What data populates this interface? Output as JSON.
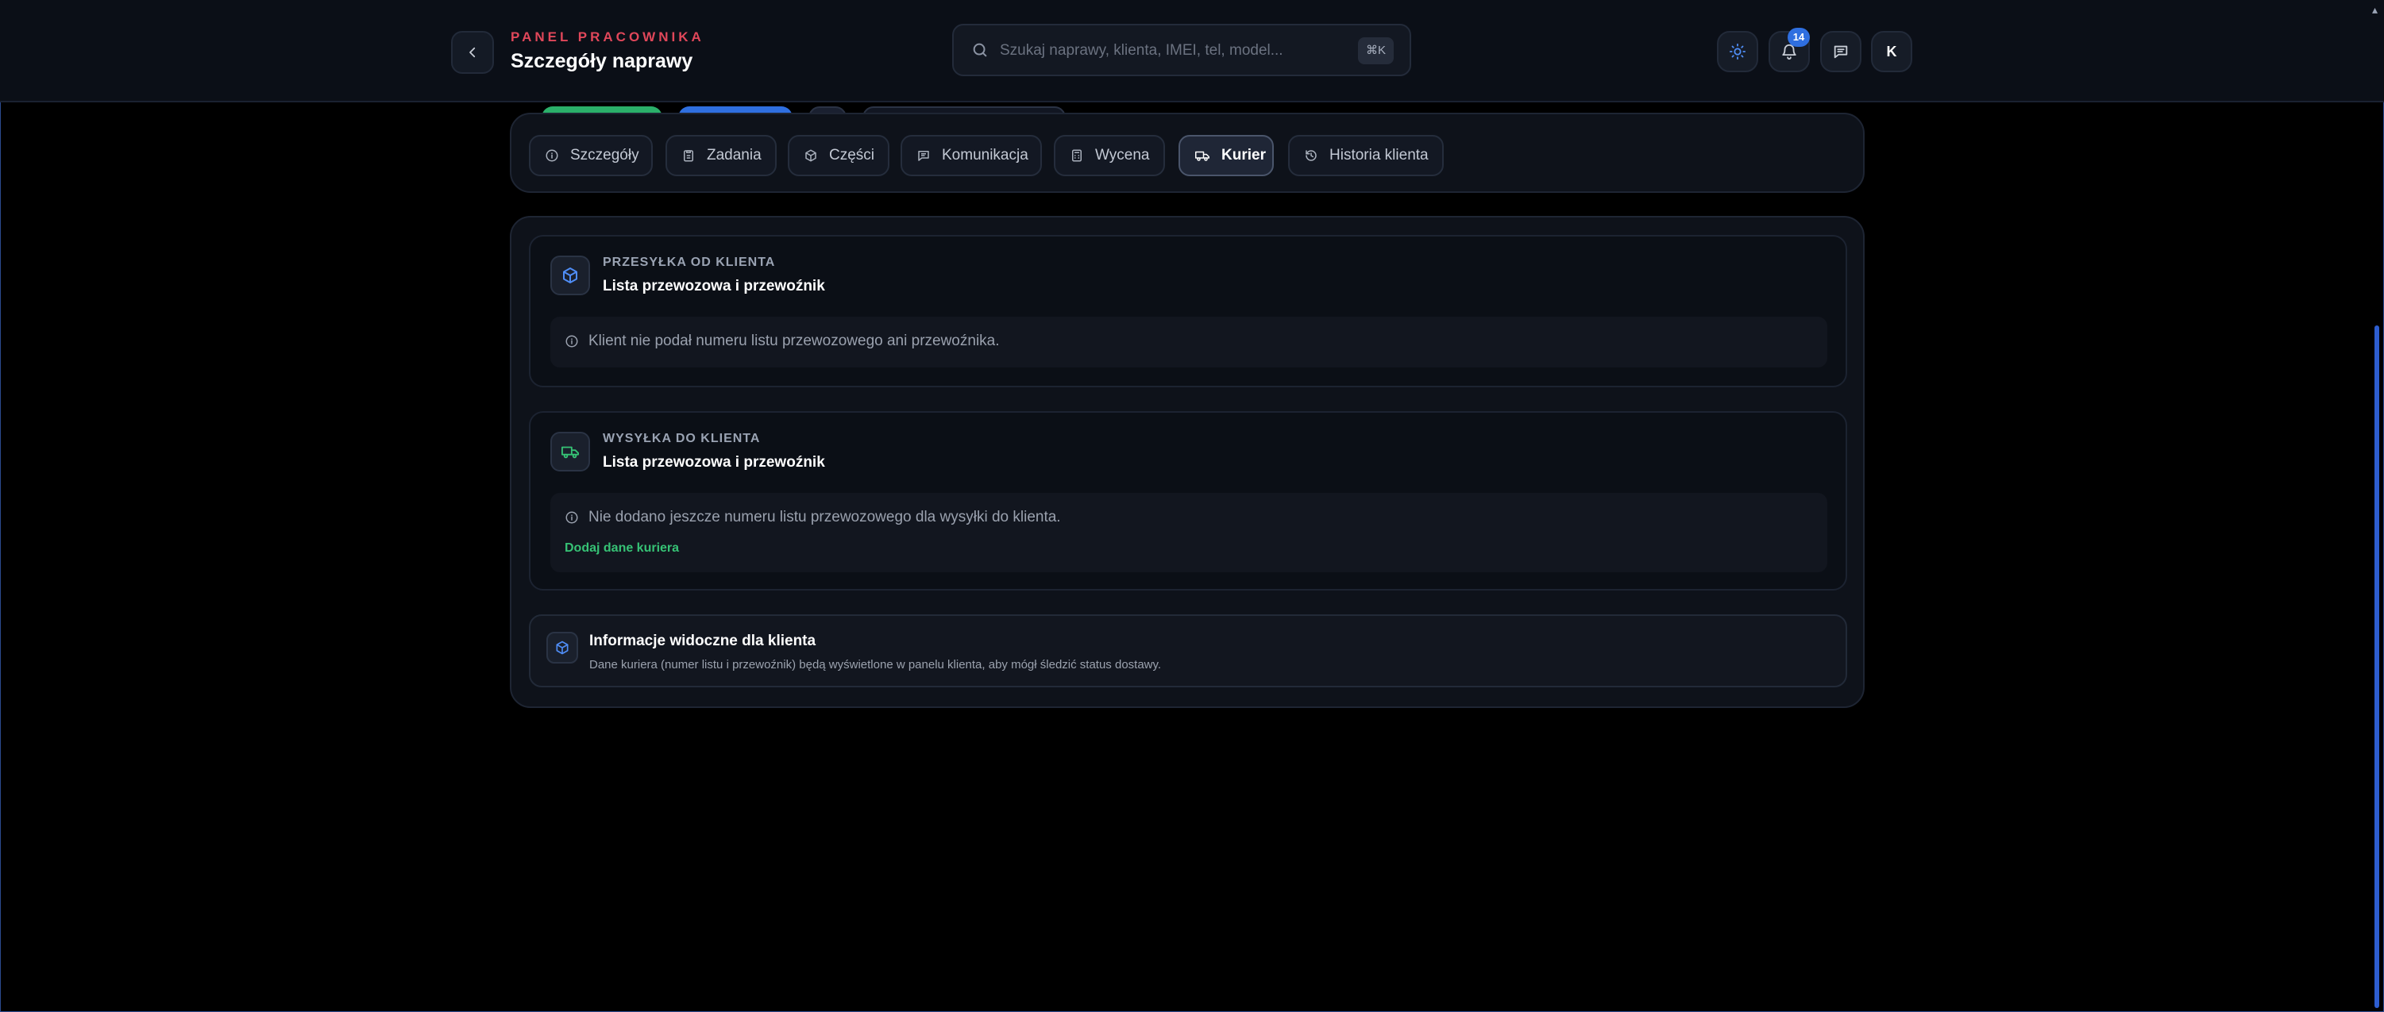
{
  "header": {
    "eyebrow": "PANEL PRACOWNIKA",
    "title": "Szczegóły naprawy",
    "search_placeholder": "Szukaj naprawy, klienta, IMEI, tel, model...",
    "search_shortcut": "⌘K",
    "notifications_count": "14",
    "avatar_initial": "K"
  },
  "tabs": [
    {
      "label": "Szczegóły",
      "icon": "info-icon",
      "active": false
    },
    {
      "label": "Zadania",
      "icon": "clipboard-icon",
      "active": false
    },
    {
      "label": "Części",
      "icon": "package-icon",
      "active": false
    },
    {
      "label": "Komunikacja",
      "icon": "chat-icon",
      "active": false
    },
    {
      "label": "Wycena",
      "icon": "calculator-icon",
      "active": false
    },
    {
      "label": "Kurier",
      "icon": "truck-icon",
      "active": true
    },
    {
      "label": "Historia klienta",
      "icon": "history-icon",
      "active": false
    }
  ],
  "incoming": {
    "eyebrow": "PRZESYŁKA OD KLIENTA",
    "title": "Lista przewozowa i przewoźnik",
    "message": "Klient nie podał numeru listu przewozowego ani przewoźnika.",
    "icon": "package-icon"
  },
  "outgoing": {
    "eyebrow": "WYSYŁKA DO KLIENTA",
    "title": "Lista przewozowa i przewoźnik",
    "message": "Nie dodano jeszcze numeru listu przewozowego dla wysyłki do klienta.",
    "action": "Dodaj dane kuriera",
    "icon": "truck-icon"
  },
  "client_info": {
    "title": "Informacje widoczne dla klienta",
    "description": "Dane kuriera (numer listu i przewoźnik) będą wyświetlone w panelu klienta, aby mógł śledzić status dostawy.",
    "icon": "package-icon"
  },
  "colors": {
    "accent": "#e0475a",
    "primary": "#2f6fe0",
    "success": "#36c275",
    "background": "#000000",
    "panel": "#0e121a"
  }
}
